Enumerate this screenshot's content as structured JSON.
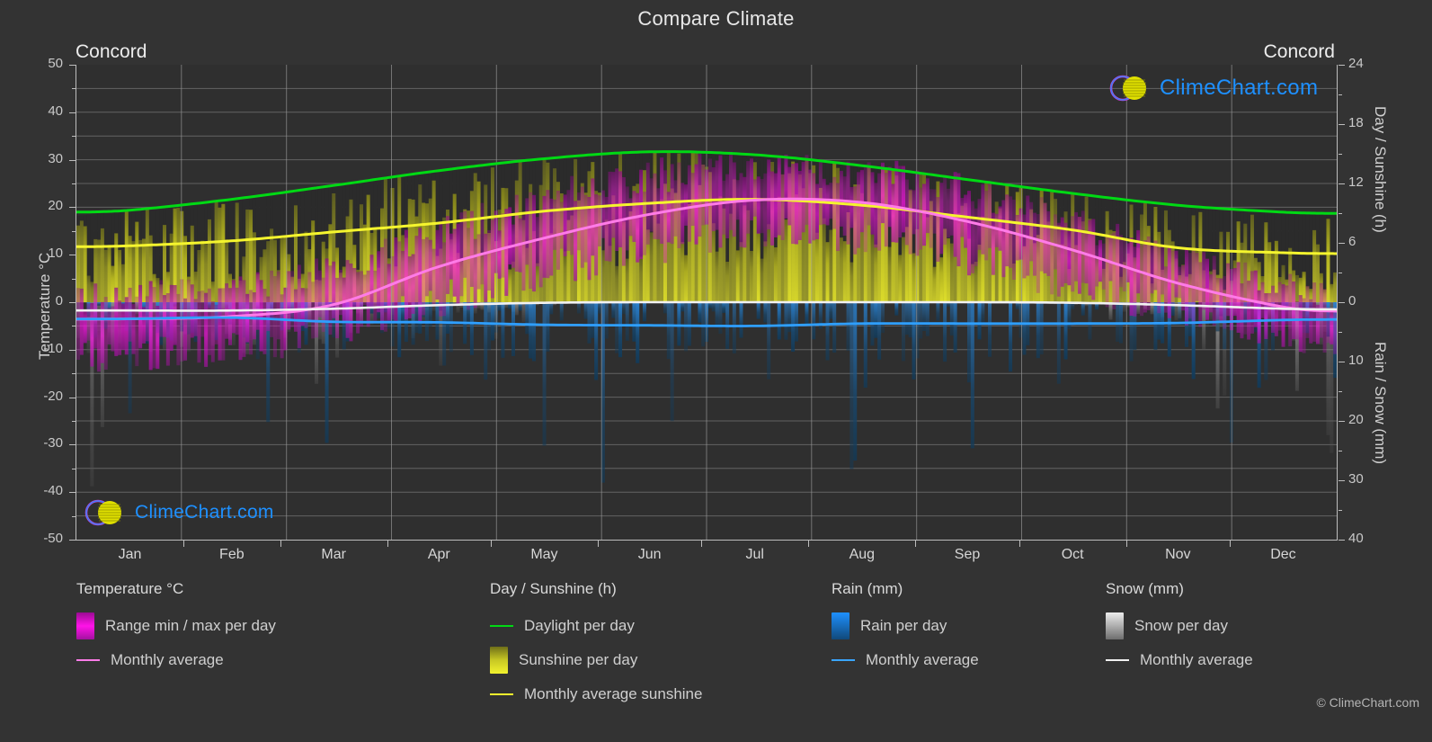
{
  "header": {
    "title": "Compare Climate",
    "city_left": "Concord",
    "city_right": "Concord"
  },
  "watermark": {
    "text": "ClimeChart.com",
    "copyright": "© ClimeChart.com"
  },
  "axes": {
    "y_left_title": "Temperature °C",
    "y_right_top_title": "Day / Sunshine (h)",
    "y_right_bottom_title": "Rain / Snow (mm)",
    "y_left_ticks": [
      "50",
      "40",
      "30",
      "20",
      "10",
      "0",
      "-10",
      "-20",
      "-30",
      "-40",
      "-50"
    ],
    "y_right_top_ticks": [
      "24",
      "18",
      "12",
      "6",
      "0"
    ],
    "y_right_bottom_ticks": [
      "0",
      "10",
      "20",
      "30",
      "40"
    ],
    "x_ticks": [
      "Jan",
      "Feb",
      "Mar",
      "Apr",
      "May",
      "Jun",
      "Jul",
      "Aug",
      "Sep",
      "Oct",
      "Nov",
      "Dec"
    ]
  },
  "legend": {
    "groups": [
      {
        "title": "Temperature °C",
        "items": [
          {
            "label": "Range min / max per day",
            "marker": "swatch",
            "color": "#ff00e0"
          },
          {
            "label": "Monthly average",
            "marker": "line",
            "color": "#ff7be8"
          }
        ]
      },
      {
        "title": "Day / Sunshine (h)",
        "items": [
          {
            "label": "Daylight per day",
            "marker": "line",
            "color": "#00d914"
          },
          {
            "label": "Sunshine per day",
            "marker": "swatch",
            "color": "#e8e81e"
          },
          {
            "label": "Monthly average sunshine",
            "marker": "line",
            "color": "#f2f230"
          }
        ]
      },
      {
        "title": "Rain (mm)",
        "items": [
          {
            "label": "Rain per day",
            "marker": "swatch",
            "color": "#1e90ff"
          },
          {
            "label": "Monthly average",
            "marker": "line",
            "color": "#3aa5ff"
          }
        ]
      },
      {
        "title": "Snow (mm)",
        "items": [
          {
            "label": "Snow per day",
            "marker": "swatch",
            "color": "#e6e6e6"
          },
          {
            "label": "Monthly average",
            "marker": "line",
            "color": "#f0f0f0"
          }
        ]
      }
    ]
  },
  "colors": {
    "background": "#333333",
    "plot_background": "#2f2f2f",
    "grid": "#8d8d8d",
    "axis": "#bdbdbd",
    "text": "#d4d4d4",
    "temp_range": "#ff00e0",
    "temp_avg": "#ff7be8",
    "daylight": "#00d914",
    "sunshine": "#d7d723",
    "sunshine_avg": "#f5f52e",
    "rain": "#1e90ff",
    "rain_avg": "#2f9fff",
    "snow": "#d9d9d9",
    "snow_avg": "#f2f2f2",
    "brand_blue": "#1e90ff",
    "brand_magenta": "#c83cd2",
    "brand_yellow": "#e0e000"
  },
  "chart_data": {
    "type": "line",
    "title": "Compare Climate",
    "subtitle": "Concord",
    "xlabel": "",
    "ylabel": "Temperature °C",
    "categories": [
      "Jan",
      "Feb",
      "Mar",
      "Apr",
      "May",
      "Jun",
      "Jul",
      "Aug",
      "Sep",
      "Oct",
      "Nov",
      "Dec"
    ],
    "ylim": [
      -50,
      50
    ],
    "ylim_right_top": [
      0,
      24
    ],
    "ylim_right_bottom": [
      0,
      40
    ],
    "grid": true,
    "legend_position": "bottom",
    "series": [
      {
        "name": "Monthly average temperature",
        "unit": "°C",
        "axis": "left",
        "color": "#ff7be8",
        "values": [
          -3.5,
          -3.0,
          -0.5,
          7.5,
          13.5,
          18.5,
          21.5,
          21.0,
          17.0,
          11.0,
          4.0,
          -1.0
        ]
      },
      {
        "name": "Daylight per day",
        "unit": "h",
        "axis": "right-top",
        "color": "#00d914",
        "values": [
          9.3,
          10.4,
          11.8,
          13.3,
          14.5,
          15.2,
          14.9,
          13.8,
          12.4,
          11.0,
          9.8,
          9.1
        ]
      },
      {
        "name": "Monthly average sunshine",
        "unit": "h",
        "axis": "right-top",
        "color": "#f5f52e",
        "values": [
          5.7,
          6.2,
          7.1,
          8.0,
          9.2,
          10.0,
          10.4,
          9.8,
          8.6,
          7.3,
          5.5,
          5.0
        ]
      },
      {
        "name": "Monthly average rain",
        "unit": "mm",
        "axis": "right-bottom",
        "color": "#2f9fff",
        "values": [
          2.8,
          2.6,
          3.3,
          3.4,
          3.8,
          3.9,
          4.0,
          3.6,
          3.6,
          3.6,
          3.5,
          3.0
        ]
      },
      {
        "name": "Monthly average snow",
        "unit": "mm",
        "axis": "right-bottom",
        "color": "#f2f2f2",
        "values": [
          1.4,
          1.4,
          1.1,
          0.5,
          0.1,
          0.0,
          0.0,
          0.0,
          0.0,
          0.1,
          0.5,
          1.1
        ]
      },
      {
        "name": "Daily temperature range max",
        "unit": "°C",
        "axis": "left",
        "color": "#ff00e0",
        "values": [
          1.5,
          2.5,
          6.5,
          14.0,
          21.0,
          26.0,
          28.0,
          27.0,
          23.0,
          16.5,
          9.5,
          3.5
        ]
      },
      {
        "name": "Daily temperature range min",
        "unit": "°C",
        "axis": "left",
        "color": "#ff00e0",
        "values": [
          -10.5,
          -9.5,
          -5.5,
          1.0,
          7.0,
          12.0,
          15.0,
          14.0,
          10.0,
          4.0,
          -1.5,
          -7.0
        ]
      }
    ]
  }
}
